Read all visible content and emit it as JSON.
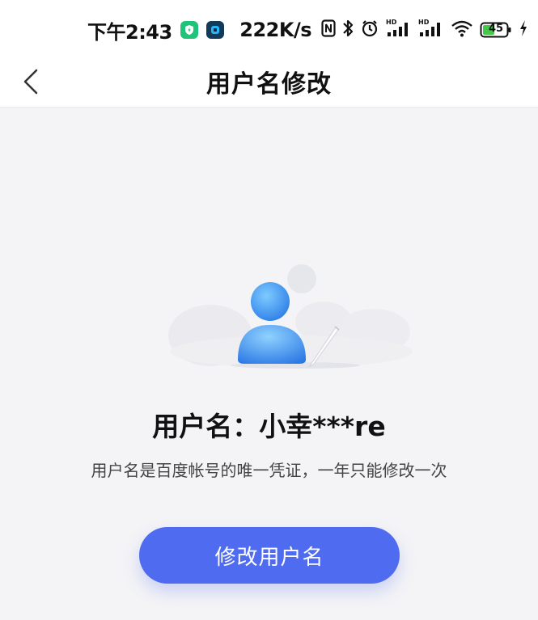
{
  "status_bar": {
    "time": "下午2:43",
    "network_speed": "222K/s",
    "battery_level": "45",
    "icons": [
      "app-shield-icon",
      "app-square-icon",
      "nfc-icon",
      "bluetooth-icon",
      "alarm-icon",
      "hd-signal-icon",
      "hd-signal-icon-2",
      "wifi-icon",
      "battery-icon",
      "charging-icon"
    ]
  },
  "nav": {
    "title": "用户名修改",
    "back_icon": "chevron-left-icon"
  },
  "profile": {
    "username_label": "用户名：",
    "username_value": "小幸***re",
    "description": "用户名是百度帐号的唯一凭证，一年只能修改一次"
  },
  "actions": {
    "edit_username_button": "修改用户名"
  },
  "colors": {
    "primary": "#4f6cf0",
    "background": "#f4f4f6",
    "avatar": "#3b8df0"
  }
}
